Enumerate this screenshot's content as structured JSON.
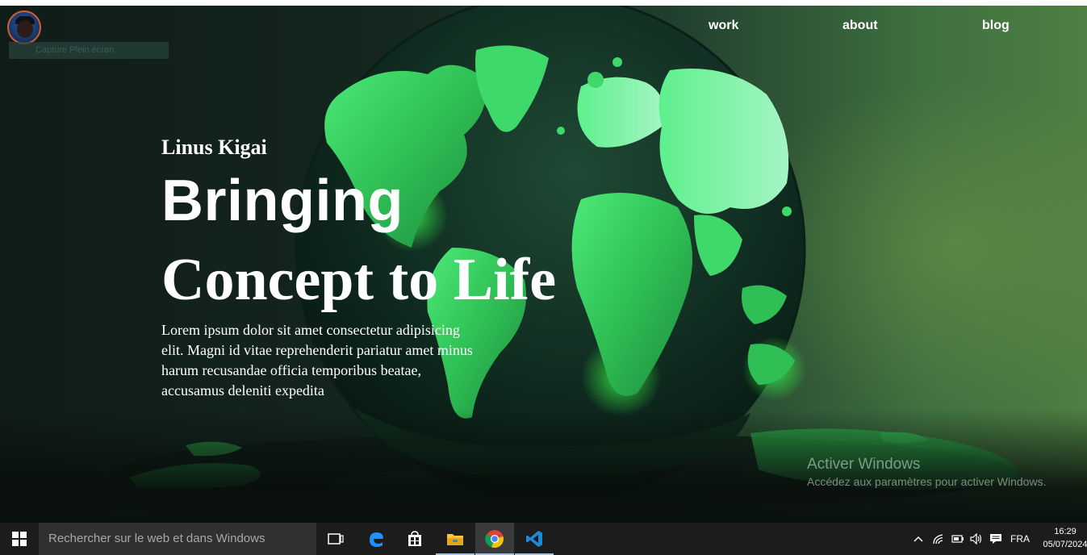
{
  "screenshot_tool": {
    "capture_label": "Capture Plein écran"
  },
  "nav": {
    "work": "work",
    "about": "about",
    "blog": "blog"
  },
  "hero": {
    "name": "Linus Kigai",
    "headline_line1": "Bringing",
    "headline_line2": "Concept to Life",
    "lead": "Lorem ipsum dolor sit amet consectetur adipisicing elit. Magni id vitae reprehenderit pariatur amet minus harum recusandae officia temporibus beatae, accusamus deleniti expedita"
  },
  "watermark": {
    "title": "Activer Windows",
    "subtitle": "Accédez aux paramètres pour activer Windows."
  },
  "taskbar": {
    "search_placeholder": "Rechercher sur le web et dans Windows",
    "apps": [
      "task-view",
      "edge",
      "store",
      "file-explorer",
      "chrome",
      "vscode"
    ],
    "language": "FRA",
    "time": "16:29",
    "date": "05/07/2024"
  },
  "colors": {
    "accent_green": "#3ecf5a",
    "taskbar_bg": "#1c1c1c",
    "search_bg": "#303030"
  }
}
